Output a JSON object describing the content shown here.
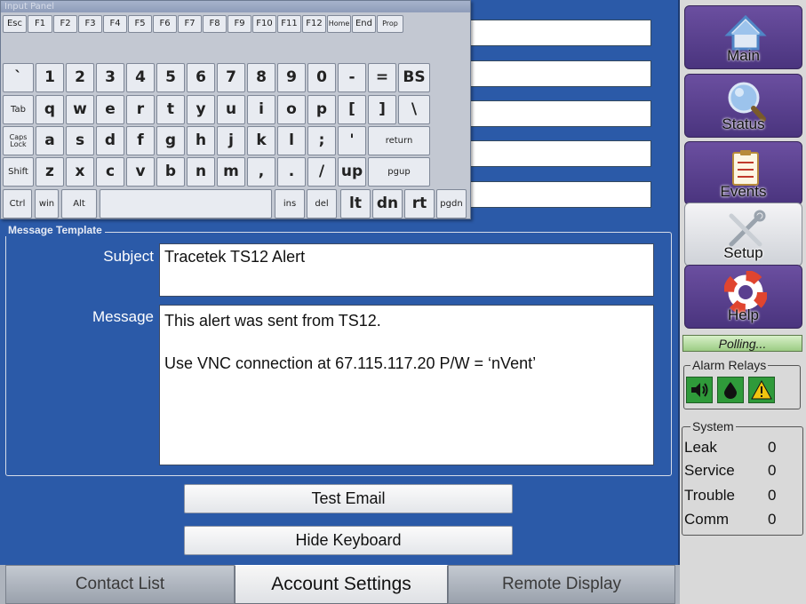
{
  "keyboard": {
    "title": "Input Panel",
    "rows": [
      [
        "Esc",
        "F1",
        "F2",
        "F3",
        "F4",
        "F5",
        "F6",
        "F7",
        "F8",
        "F9",
        "F10",
        "F11",
        "F12",
        "Home",
        "End",
        "Prop"
      ],
      [
        "`",
        "1",
        "2",
        "3",
        "4",
        "5",
        "6",
        "7",
        "8",
        "9",
        "0",
        "-",
        "=",
        "BS"
      ],
      [
        "Tab",
        "q",
        "w",
        "e",
        "r",
        "t",
        "y",
        "u",
        "i",
        "o",
        "p",
        "[",
        "]",
        "\\"
      ],
      [
        "Caps Lock",
        "a",
        "s",
        "d",
        "f",
        "g",
        "h",
        "j",
        "k",
        "l",
        ";",
        "'",
        "return"
      ],
      [
        "Shift",
        "z",
        "x",
        "c",
        "v",
        "b",
        "n",
        "m",
        ",",
        ".",
        "/",
        "up",
        "pgup"
      ],
      [
        "Ctrl",
        "win",
        "Alt",
        "",
        "ins",
        "del",
        "lt",
        "dn",
        "rt",
        "pgdn"
      ]
    ]
  },
  "message_template": {
    "title": "Message Template",
    "subject_label": "Subject",
    "subject_value": "Tracetek TS12 Alert",
    "message_label": "Message",
    "message_lines": [
      "This alert was sent from TS12.",
      "",
      "Use VNC connection at 67.115.117.20   P/W =  ‘nVent’"
    ]
  },
  "buttons": {
    "test_email": "Test Email",
    "hide_keyboard": "Hide Keyboard"
  },
  "tabs": [
    {
      "label": "Contact List",
      "active": false
    },
    {
      "label": "Account Settings",
      "active": true
    },
    {
      "label": "Remote Display",
      "active": false
    }
  ],
  "sidebar": {
    "nav": [
      {
        "label": "Main",
        "icon": "home-icon",
        "active": false
      },
      {
        "label": "Status",
        "icon": "magnifier-icon",
        "active": false
      },
      {
        "label": "Events",
        "icon": "clipboard-icon",
        "active": false
      },
      {
        "label": "Setup",
        "icon": "tools-icon",
        "active": true
      },
      {
        "label": "Help",
        "icon": "lifebuoy-icon",
        "active": false
      }
    ],
    "polling_text": "Polling...",
    "alarm_relays": {
      "title": "Alarm Relays",
      "icons": [
        "speaker-icon",
        "drop-icon",
        "warning-icon"
      ]
    },
    "system": {
      "title": "System",
      "rows": [
        {
          "label": "Leak",
          "value": "0"
        },
        {
          "label": "Service",
          "value": "0"
        },
        {
          "label": "Trouble",
          "value": "0"
        },
        {
          "label": "Comm",
          "value": "0"
        }
      ]
    }
  },
  "colors": {
    "panel_blue": "#2b5aa8",
    "nav_purple": "#5a3f8f",
    "relay_green": "#2f9a3a",
    "polling_green": "#9ccc84"
  }
}
